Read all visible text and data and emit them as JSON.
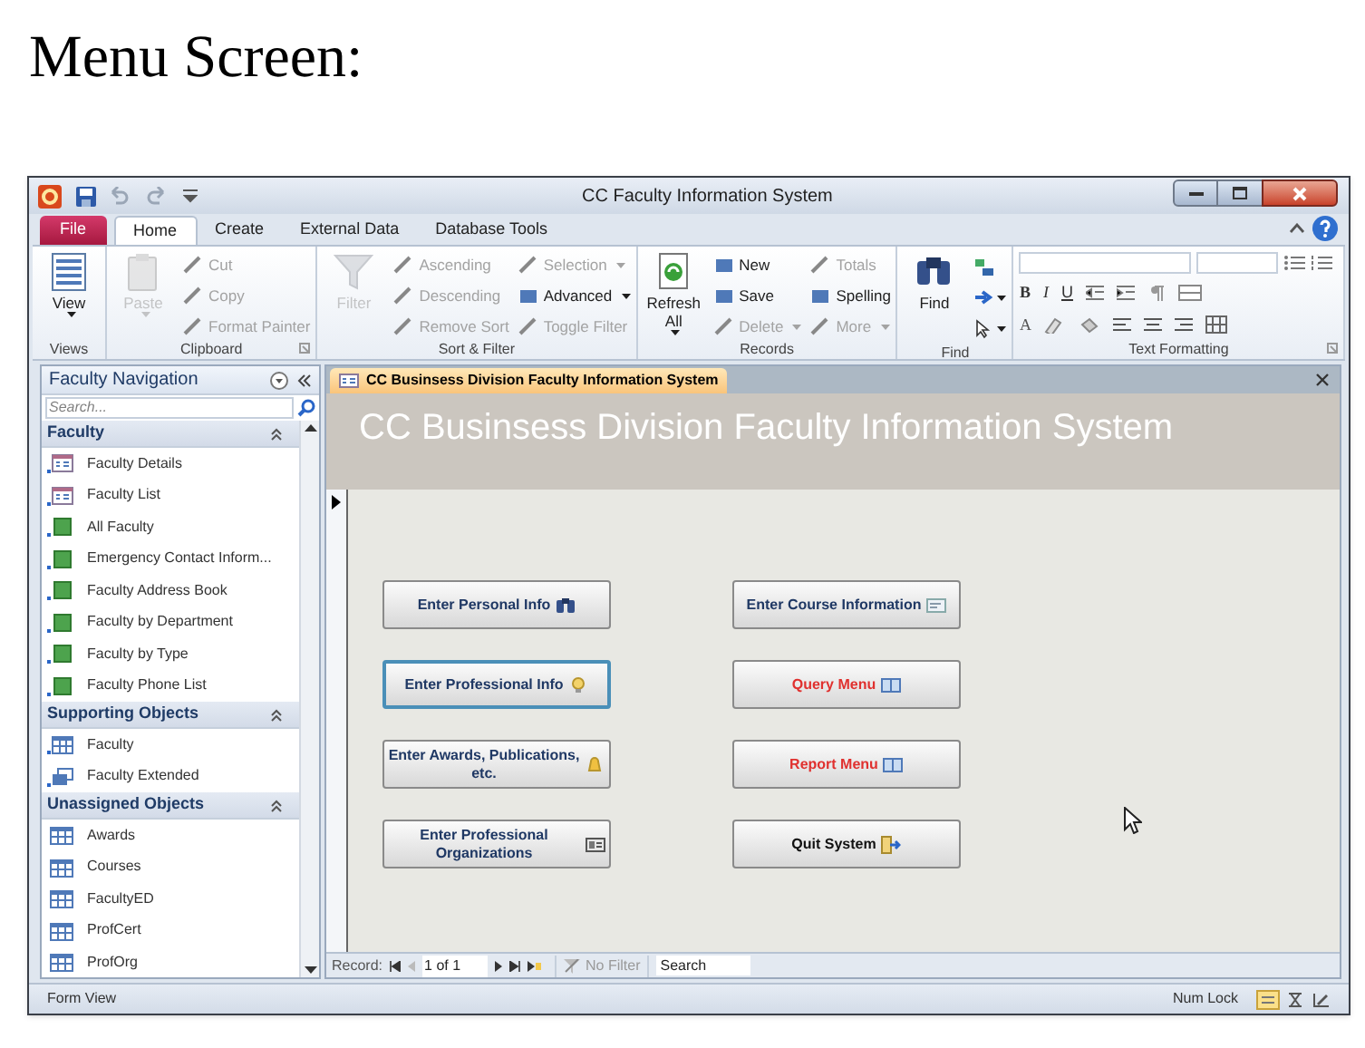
{
  "heading": "Menu Screen:",
  "window": {
    "title": "CC Faculty Information System"
  },
  "ribbon_tabs": [
    {
      "label": "File",
      "kind": "file",
      "selected": false
    },
    {
      "label": "Home",
      "kind": "tab",
      "selected": true
    },
    {
      "label": "Create",
      "kind": "tab",
      "selected": false
    },
    {
      "label": "External Data",
      "kind": "tab",
      "selected": false
    },
    {
      "label": "Database Tools",
      "kind": "tab",
      "selected": false
    }
  ],
  "ribbon_groups": [
    {
      "label": "Views",
      "launcher": false,
      "columns": [
        [
          {
            "label": "View",
            "kind": "large",
            "disabled": false,
            "dropdown": true
          }
        ]
      ]
    },
    {
      "label": "Clipboard",
      "launcher": true,
      "columns": [
        [
          {
            "label": "Paste",
            "kind": "large",
            "disabled": true,
            "dropdown": true
          }
        ],
        [
          {
            "label": "Cut",
            "kind": "small",
            "disabled": true,
            "dropdown": false
          },
          {
            "label": "Copy",
            "kind": "small",
            "disabled": true,
            "dropdown": false
          },
          {
            "label": "Format Painter",
            "kind": "small",
            "disabled": true,
            "dropdown": false
          }
        ]
      ]
    },
    {
      "label": "Sort & Filter",
      "launcher": false,
      "columns": [
        [
          {
            "label": "Filter",
            "kind": "large",
            "disabled": true,
            "dropdown": false
          }
        ],
        [
          {
            "label": "Ascending",
            "kind": "small",
            "disabled": true,
            "dropdown": false
          },
          {
            "label": "Descending",
            "kind": "small",
            "disabled": true,
            "dropdown": false
          },
          {
            "label": "Remove Sort",
            "kind": "small",
            "disabled": true,
            "dropdown": false
          }
        ],
        [
          {
            "label": "Selection",
            "kind": "small",
            "disabled": true,
            "dropdown": true
          },
          {
            "label": "Advanced",
            "kind": "small",
            "disabled": false,
            "dropdown": true
          },
          {
            "label": "Toggle Filter",
            "kind": "small",
            "disabled": true,
            "dropdown": false
          }
        ]
      ]
    },
    {
      "label": "Records",
      "launcher": false,
      "columns": [
        [
          {
            "label": "Refresh All",
            "kind": "large",
            "disabled": false,
            "dropdown": true
          }
        ],
        [
          {
            "label": "New",
            "kind": "small",
            "disabled": false,
            "dropdown": false
          },
          {
            "label": "Save",
            "kind": "small",
            "disabled": false,
            "dropdown": false
          },
          {
            "label": "Delete",
            "kind": "small",
            "disabled": true,
            "dropdown": true
          }
        ],
        [
          {
            "label": "Totals",
            "kind": "small",
            "disabled": true,
            "dropdown": false
          },
          {
            "label": "Spelling",
            "kind": "small",
            "disabled": false,
            "dropdown": false
          },
          {
            "label": "More",
            "kind": "small",
            "disabled": true,
            "dropdown": true
          }
        ]
      ]
    },
    {
      "label": "Find",
      "launcher": false,
      "columns": [
        [
          {
            "label": "Find",
            "kind": "large",
            "disabled": false,
            "dropdown": false
          }
        ],
        [
          {
            "kind": "icon",
            "disabled": false,
            "dropdown": false
          },
          {
            "kind": "icon",
            "disabled": false,
            "dropdown": true
          },
          {
            "kind": "icon",
            "disabled": false,
            "dropdown": true
          }
        ]
      ]
    }
  ],
  "text_formatting": {
    "label": "Text Formatting",
    "launcher": true,
    "glyphs": [
      "B",
      "I",
      "U",
      "A"
    ]
  },
  "navigation": {
    "title": "Faculty Navigation",
    "placeholder": "Search...",
    "groups": [
      {
        "label": "Faculty",
        "expanded": true,
        "items": [
          {
            "label": "Faculty Details",
            "kind": "form"
          },
          {
            "label": "Faculty List",
            "kind": "form"
          },
          {
            "label": "All Faculty",
            "kind": "report"
          },
          {
            "label": "Emergency Contact Inform...",
            "kind": "report"
          },
          {
            "label": "Faculty Address Book",
            "kind": "report"
          },
          {
            "label": "Faculty by Department",
            "kind": "report"
          },
          {
            "label": "Faculty by Type",
            "kind": "report"
          },
          {
            "label": "Faculty Phone List",
            "kind": "report"
          }
        ]
      },
      {
        "label": "Supporting Objects",
        "expanded": true,
        "items": [
          {
            "label": "Faculty",
            "kind": "linked_table"
          },
          {
            "label": "Faculty Extended",
            "kind": "query"
          }
        ]
      },
      {
        "label": "Unassigned Objects",
        "expanded": true,
        "items": [
          {
            "label": "Awards",
            "kind": "table"
          },
          {
            "label": "Courses",
            "kind": "table"
          },
          {
            "label": "FacultyED",
            "kind": "table"
          },
          {
            "label": "ProfCert",
            "kind": "table"
          },
          {
            "label": "ProfOrg",
            "kind": "table"
          }
        ]
      }
    ]
  },
  "document_tab": {
    "label": "CC Businsess Division Faculty Information System"
  },
  "form_title": "CC Businsess Division Faculty Information System",
  "buttons": [
    {
      "label": "Enter Personal Info",
      "color": "#1f3864",
      "focused": false
    },
    {
      "label": "Enter Course Information",
      "color": "#1f3864",
      "focused": false
    },
    {
      "label": "Enter Professional Info",
      "color": "#1f3864",
      "focused": true
    },
    {
      "label": "Query Menu",
      "color": "#e0312f",
      "focused": false
    },
    {
      "label": "Enter Awards, Publications, etc.",
      "color": "#1f3864",
      "focused": false
    },
    {
      "label": "Report Menu",
      "color": "#e0312f",
      "focused": false
    },
    {
      "label": "Enter Professional Organizations",
      "color": "#1f3864",
      "focused": false
    },
    {
      "label": "Quit System",
      "color": "#111111",
      "focused": false
    }
  ],
  "record_nav": {
    "label": "Record:",
    "position": "1 of 1",
    "filter": "No Filter",
    "placeholder": "Search"
  },
  "status_bar": {
    "left": "Form View",
    "right": "Num Lock"
  }
}
